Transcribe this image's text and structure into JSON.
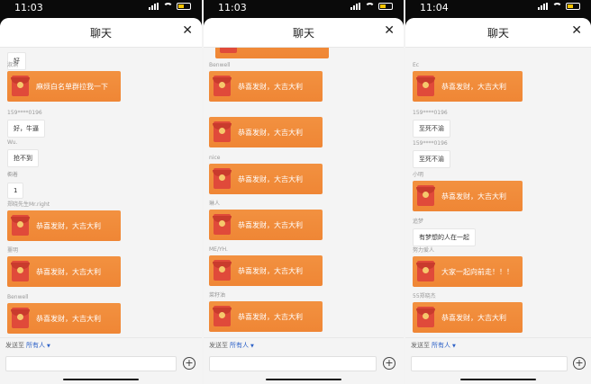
{
  "header_title": "聊天",
  "send_to_label": "发送至",
  "send_to_target": "所有人",
  "panels": [
    {
      "time": "11:03",
      "messages": [
        {
          "type": "text",
          "sender": "",
          "text": "好"
        },
        {
          "type": "redpacket",
          "sender": "淑满",
          "text": "麻烦白名单群拉我一下"
        },
        {
          "type": "text",
          "sender": "159****0196",
          "text": "好，牛逼"
        },
        {
          "type": "text",
          "sender": "Wu.",
          "text": "抢不到"
        },
        {
          "type": "text",
          "sender": "橱着",
          "text": "1"
        },
        {
          "type": "redpacket",
          "sender": "郑晓先生Mr.right",
          "text": "恭喜发财，大吉大利"
        },
        {
          "type": "redpacket",
          "sender": "薹明",
          "text": "恭喜发财，大吉大利"
        },
        {
          "type": "redpacket",
          "sender": "Benwell",
          "text": "恭喜发财，大吉大利"
        }
      ]
    },
    {
      "time": "11:03",
      "messages": [
        {
          "type": "redpacket",
          "sender": "",
          "text": ""
        },
        {
          "type": "redpacket",
          "sender": "Benwell",
          "text": "恭喜发财，大吉大利"
        },
        {
          "type": "redpacket",
          "sender": "",
          "text": "恭喜发财，大吉大利"
        },
        {
          "type": "redpacket",
          "sender": "nice",
          "text": "恭喜发财，大吉大利"
        },
        {
          "type": "redpacket",
          "sender": "琳人",
          "text": "恭喜发财，大吉大利"
        },
        {
          "type": "redpacket",
          "sender": "ME/YH.",
          "text": "恭喜发财，大吉大利"
        },
        {
          "type": "redpacket",
          "sender": "菜籽油",
          "text": "恭喜发财，大吉大利"
        }
      ]
    },
    {
      "time": "11:04",
      "messages": [
        {
          "type": "redpacket",
          "sender": "Ec",
          "text": "恭喜发财，大吉大利"
        },
        {
          "type": "text",
          "sender": "159****0196",
          "text": "至死不渝"
        },
        {
          "type": "text",
          "sender": "159****0196",
          "text": "至死不渝"
        },
        {
          "type": "redpacket",
          "sender": "小明",
          "text": "恭喜发财，大吉大利"
        },
        {
          "type": "text",
          "sender": "追梦",
          "text": "有梦想的人在一起"
        },
        {
          "type": "redpacket",
          "sender": "努力爱人",
          "text": "大家一起向前走！！！"
        },
        {
          "type": "redpacket",
          "sender": "55郑晓杰",
          "text": "恭喜发财，大吉大利"
        }
      ]
    }
  ]
}
